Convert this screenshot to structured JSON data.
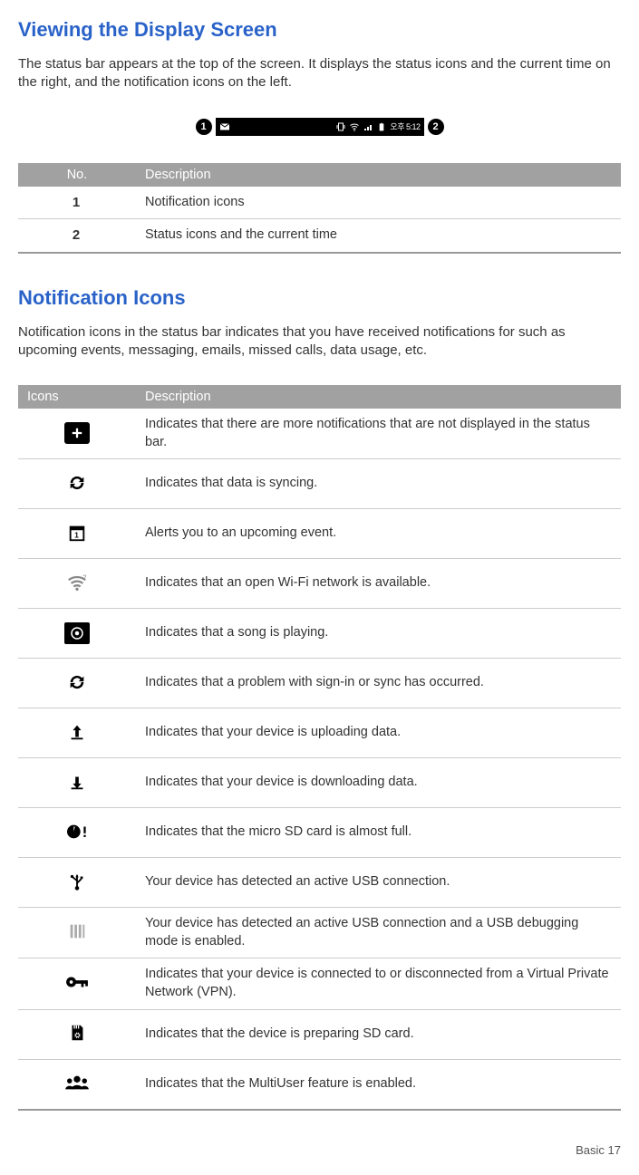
{
  "section1": {
    "title": "Viewing the Display Screen",
    "intro": "The status bar appears at the top of the screen. It displays the status icons and the current time on the right, and the notification icons on the   left.",
    "statusbar_time": "오후 5:12"
  },
  "table1": {
    "headers": {
      "col1": "No.",
      "col2": "Description"
    },
    "rows": [
      {
        "no": "1",
        "desc": "Notification icons"
      },
      {
        "no": "2",
        "desc": "Status icons and the current  time"
      }
    ]
  },
  "section2": {
    "title": "Notification Icons",
    "intro": "Notification icons in the status bar indicates that you have received notifications for such as upcoming events, messaging, emails, missed calls, data usage,  etc."
  },
  "table2": {
    "headers": {
      "col1": "Icons",
      "col2": "Description"
    },
    "rows": [
      {
        "icon": "more-notifications-icon",
        "desc": "Indicates that there are more notifications that are not displayed in the status bar."
      },
      {
        "icon": "sync-icon",
        "desc": "Indicates that data is  syncing."
      },
      {
        "icon": "calendar-event-icon",
        "desc": "Alerts you to an upcoming  event."
      },
      {
        "icon": "wifi-open-icon",
        "desc": "Indicates that an open Wi-Fi network is  available."
      },
      {
        "icon": "music-playing-icon",
        "desc": "Indicates that a song is  playing."
      },
      {
        "icon": "sync-error-icon",
        "desc": "Indicates that a problem with sign-in or sync has   occurred."
      },
      {
        "icon": "upload-icon",
        "desc": "Indicates that your device is uploading  data."
      },
      {
        "icon": "download-icon",
        "desc": "Indicates that your device is downloading  data."
      },
      {
        "icon": "sd-almost-full-icon",
        "desc": "Indicates that the micro SD card is almost  full."
      },
      {
        "icon": "usb-connected-icon",
        "desc": "Your device has detected an active USB   connection."
      },
      {
        "icon": "usb-debugging-icon",
        "desc": "Your device has detected an active USB connection and a USB debugging mode is enabled."
      },
      {
        "icon": "vpn-icon",
        "desc": "Indicates that your device is connected to or disconnected from a Virtual Private Network (VPN)."
      },
      {
        "icon": "sd-preparing-icon",
        "desc": "Indicates that the device is preparing SD  card."
      },
      {
        "icon": "multi-user-icon",
        "desc": "Indicates that the MultiUser feature is  enabled."
      }
    ]
  },
  "page_footer": "Basic   17"
}
